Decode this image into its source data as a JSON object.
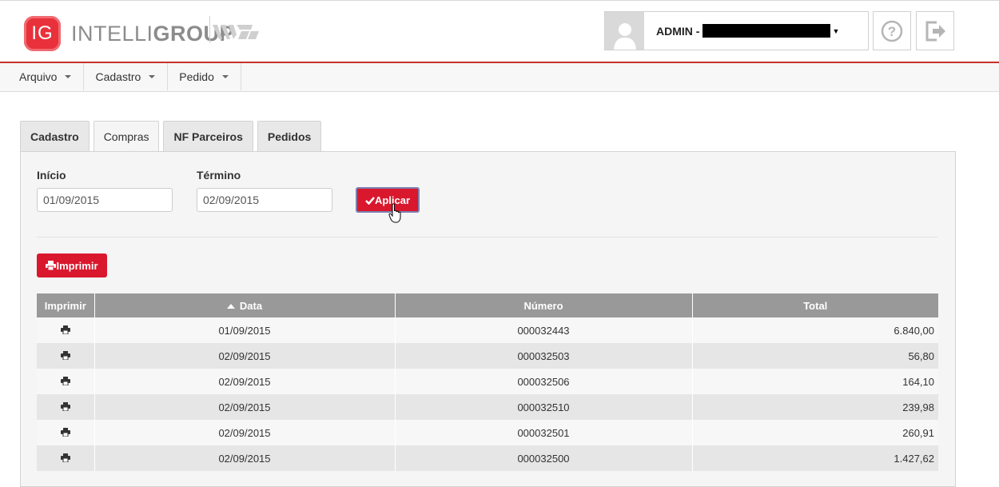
{
  "header": {
    "logo_mark": "IG",
    "logo_text_light": "INTELLI",
    "logo_text_bold": "GROUP",
    "user_label": "ADMIN -",
    "help_icon": "question-circle-icon",
    "logout_icon": "sign-out-icon"
  },
  "menu": [
    {
      "label": "Arquivo"
    },
    {
      "label": "Cadastro"
    },
    {
      "label": "Pedido"
    }
  ],
  "tabs": [
    {
      "label": "Cadastro",
      "active": false
    },
    {
      "label": "Compras",
      "active": true
    },
    {
      "label": "NF Parceiros",
      "active": false
    },
    {
      "label": "Pedidos",
      "active": false
    }
  ],
  "filters": {
    "inicio_label": "Início",
    "inicio_value": "01/09/2015",
    "termino_label": "Término",
    "termino_value": "02/09/2015",
    "apply_label": "Aplicar"
  },
  "print_button_label": "Imprimir",
  "table": {
    "columns": [
      "Imprimir",
      "Data",
      "Número",
      "Total"
    ],
    "rows": [
      {
        "data": "01/09/2015",
        "numero": "000032443",
        "total": "6.840,00"
      },
      {
        "data": "02/09/2015",
        "numero": "000032503",
        "total": "56,80"
      },
      {
        "data": "02/09/2015",
        "numero": "000032506",
        "total": "164,10"
      },
      {
        "data": "02/09/2015",
        "numero": "000032510",
        "total": "239,98"
      },
      {
        "data": "02/09/2015",
        "numero": "000032501",
        "total": "260,91"
      },
      {
        "data": "02/09/2015",
        "numero": "000032500",
        "total": "1.427,62"
      }
    ]
  },
  "colors": {
    "accent_red": "#d9182d",
    "header_border": "#c9302c",
    "table_header": "#999999"
  }
}
